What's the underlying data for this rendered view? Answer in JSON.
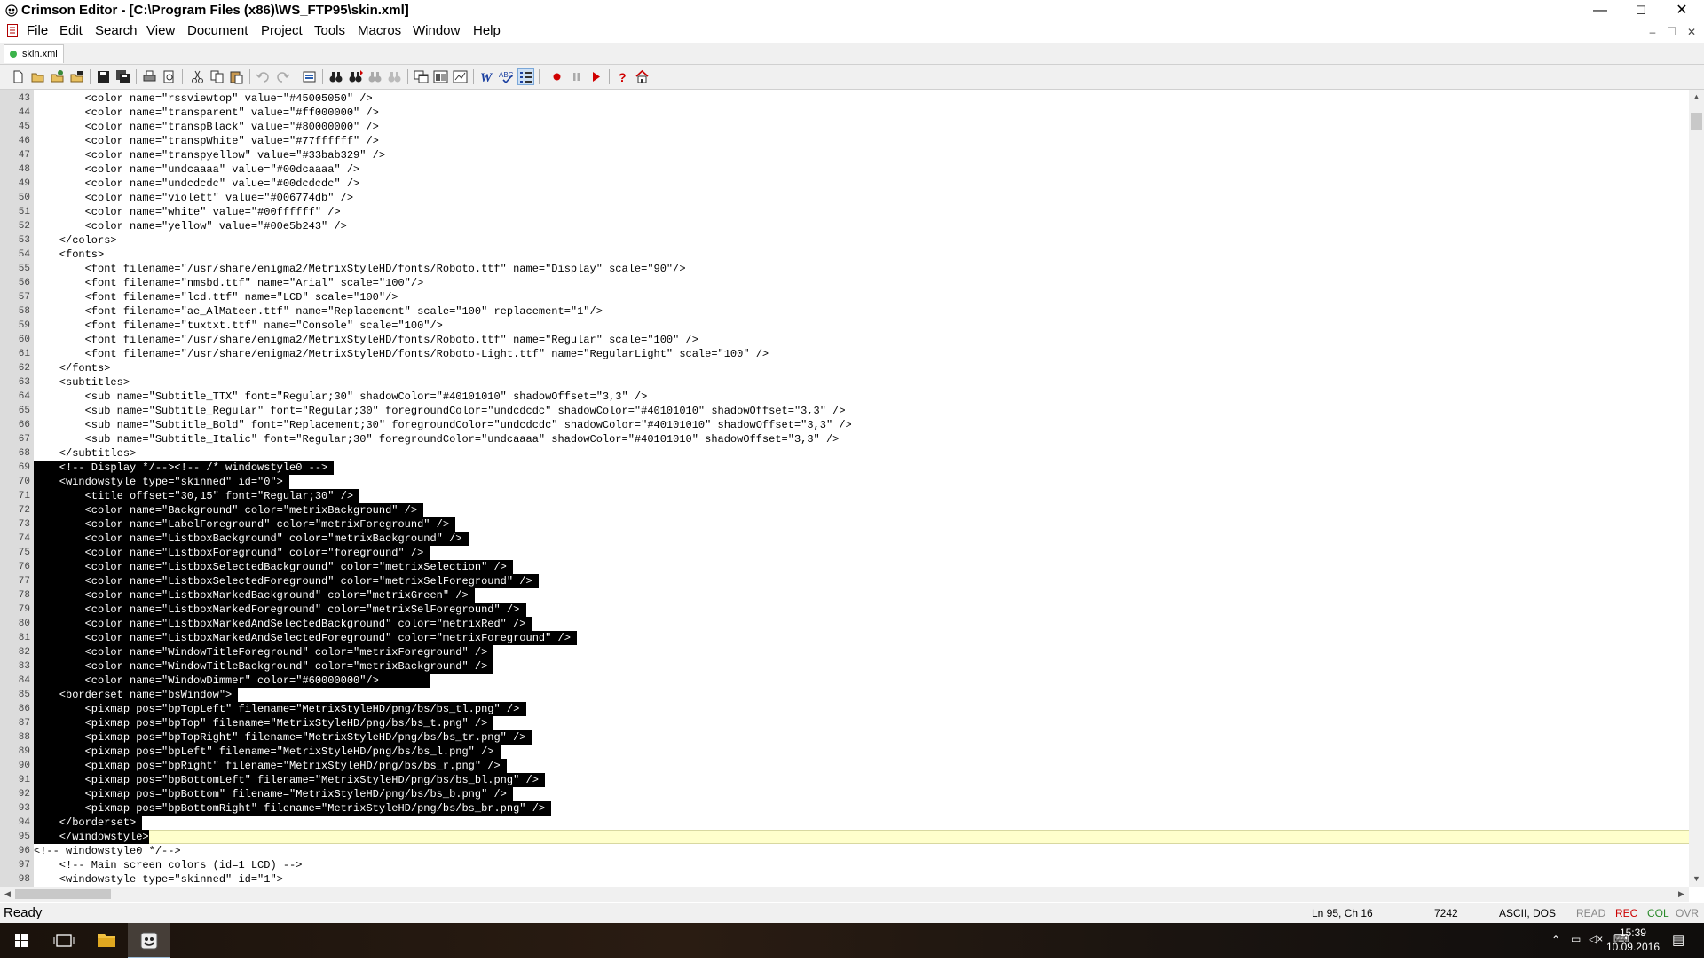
{
  "window": {
    "title": "Crimson Editor - [C:\\Program Files (x86)\\WS_FTP95\\skin.xml]",
    "controls": {
      "minimize": "—",
      "maximize": "☐",
      "close": "✕"
    }
  },
  "menu": [
    "File",
    "Edit",
    "Search",
    "View",
    "Document",
    "Project",
    "Tools",
    "Macros",
    "Window",
    "Help"
  ],
  "mdi_controls": {
    "minimize": "–",
    "restore": "❐",
    "close": "✕"
  },
  "tabs": [
    {
      "label": "skin.xml"
    }
  ],
  "toolbar_icons": [
    "new-file-icon",
    "open-folder-icon",
    "open-remote-icon",
    "close-file-icon",
    "save-icon",
    "save-all-icon",
    "print-icon",
    "print-preview-icon",
    "cut-icon",
    "copy-icon",
    "paste-icon",
    "undo-icon",
    "redo-icon",
    "select-block-icon",
    "find-icon",
    "find-next-icon",
    "replace-icon",
    "goto-icon",
    "word-wrap-icon",
    "spell-check-icon",
    "line-numbers-icon",
    "record-macro-icon",
    "pause-macro-icon",
    "play-macro-icon",
    "help-icon",
    "home-icon"
  ],
  "colors": {
    "selection_bg": "#000000",
    "selection_fg": "#ffffff",
    "current_line_bg": "#ffffcc",
    "gutter_bg": "#dcdcdc"
  },
  "editor": {
    "lines": [
      {
        "num": "43",
        "text": "        <color name=\"rssviewtop\" value=\"#45005050\" />"
      },
      {
        "num": "44",
        "text": "        <color name=\"transparent\" value=\"#ff000000\" />"
      },
      {
        "num": "45",
        "text": "        <color name=\"transpBlack\" value=\"#80000000\" />"
      },
      {
        "num": "46",
        "text": "        <color name=\"transpWhite\" value=\"#77ffffff\" />"
      },
      {
        "num": "47",
        "text": "        <color name=\"transpyellow\" value=\"#33bab329\" />"
      },
      {
        "num": "48",
        "text": "        <color name=\"undcaaaa\" value=\"#00dcaaaa\" />"
      },
      {
        "num": "49",
        "text": "        <color name=\"undcdcdc\" value=\"#00dcdcdc\" />"
      },
      {
        "num": "50",
        "text": "        <color name=\"violett\" value=\"#006774db\" />"
      },
      {
        "num": "51",
        "text": "        <color name=\"white\" value=\"#00ffffff\" />"
      },
      {
        "num": "52",
        "text": "        <color name=\"yellow\" value=\"#00e5b243\" />"
      },
      {
        "num": "53",
        "text": "    </colors>"
      },
      {
        "num": "54",
        "text": "    <fonts>"
      },
      {
        "num": "55",
        "text": "        <font filename=\"/usr/share/enigma2/MetrixStyleHD/fonts/Roboto.ttf\" name=\"Display\" scale=\"90\"/>"
      },
      {
        "num": "56",
        "text": "        <font filename=\"nmsbd.ttf\" name=\"Arial\" scale=\"100\"/>"
      },
      {
        "num": "57",
        "text": "        <font filename=\"lcd.ttf\" name=\"LCD\" scale=\"100\"/>"
      },
      {
        "num": "58",
        "text": "        <font filename=\"ae_AlMateen.ttf\" name=\"Replacement\" scale=\"100\" replacement=\"1\"/>"
      },
      {
        "num": "59",
        "text": "        <font filename=\"tuxtxt.ttf\" name=\"Console\" scale=\"100\"/>"
      },
      {
        "num": "60",
        "text": "        <font filename=\"/usr/share/enigma2/MetrixStyleHD/fonts/Roboto.ttf\" name=\"Regular\" scale=\"100\" />"
      },
      {
        "num": "61",
        "text": "        <font filename=\"/usr/share/enigma2/MetrixStyleHD/fonts/Roboto-Light.ttf\" name=\"RegularLight\" scale=\"100\" />"
      },
      {
        "num": "62",
        "text": "    </fonts>"
      },
      {
        "num": "63",
        "text": "    <subtitles>"
      },
      {
        "num": "64",
        "text": "        <sub name=\"Subtitle_TTX\" font=\"Regular;30\" shadowColor=\"#40101010\" shadowOffset=\"3,3\" />"
      },
      {
        "num": "65",
        "text": "        <sub name=\"Subtitle_Regular\" font=\"Regular;30\" foregroundColor=\"undcdcdc\" shadowColor=\"#40101010\" shadowOffset=\"3,3\" />"
      },
      {
        "num": "66",
        "text": "        <sub name=\"Subtitle_Bold\" font=\"Replacement;30\" foregroundColor=\"undcdcdc\" shadowColor=\"#40101010\" shadowOffset=\"3,3\" />"
      },
      {
        "num": "67",
        "text": "        <sub name=\"Subtitle_Italic\" font=\"Regular;30\" foregroundColor=\"undcaaaa\" shadowColor=\"#40101010\" shadowOffset=\"3,3\" />"
      },
      {
        "num": "68",
        "text": "    </subtitles>"
      },
      {
        "num": "69",
        "text": "    <!-- Display */--><!-- /* windowstyle0 --> ",
        "sel": true
      },
      {
        "num": "70",
        "text": "    <windowstyle type=\"skinned\" id=\"0\"> ",
        "sel": true
      },
      {
        "num": "71",
        "text": "        <title offset=\"30,15\" font=\"Regular;30\" /> ",
        "sel": true
      },
      {
        "num": "72",
        "text": "        <color name=\"Background\" color=\"metrixBackground\" /> ",
        "sel": true
      },
      {
        "num": "73",
        "text": "        <color name=\"LabelForeground\" color=\"metrixForeground\" /> ",
        "sel": true
      },
      {
        "num": "74",
        "text": "        <color name=\"ListboxBackground\" color=\"metrixBackground\" /> ",
        "sel": true
      },
      {
        "num": "75",
        "text": "        <color name=\"ListboxForeground\" color=\"foreground\" /> ",
        "sel": true
      },
      {
        "num": "76",
        "text": "        <color name=\"ListboxSelectedBackground\" color=\"metrixSelection\" /> ",
        "sel": true
      },
      {
        "num": "77",
        "text": "        <color name=\"ListboxSelectedForeground\" color=\"metrixSelForeground\" /> ",
        "sel": true
      },
      {
        "num": "78",
        "text": "        <color name=\"ListboxMarkedBackground\" color=\"metrixGreen\" /> ",
        "sel": true
      },
      {
        "num": "79",
        "text": "        <color name=\"ListboxMarkedForeground\" color=\"metrixSelForeground\" /> ",
        "sel": true
      },
      {
        "num": "80",
        "text": "        <color name=\"ListboxMarkedAndSelectedBackground\" color=\"metrixRed\" /> ",
        "sel": true
      },
      {
        "num": "81",
        "text": "        <color name=\"ListboxMarkedAndSelectedForeground\" color=\"metrixForeground\" /> ",
        "sel": true
      },
      {
        "num": "82",
        "text": "        <color name=\"WindowTitleForeground\" color=\"metrixForeground\" /> ",
        "sel": true
      },
      {
        "num": "83",
        "text": "        <color name=\"WindowTitleBackground\" color=\"metrixBackground\" /> ",
        "sel": true
      },
      {
        "num": "84",
        "text": "        <color name=\"WindowDimmer\" color=\"#60000000\"/>        ",
        "sel": true
      },
      {
        "num": "85",
        "text": "    <borderset name=\"bsWindow\"> ",
        "sel": true
      },
      {
        "num": "86",
        "text": "        <pixmap pos=\"bpTopLeft\" filename=\"MetrixStyleHD/png/bs/bs_tl.png\" /> ",
        "sel": true
      },
      {
        "num": "87",
        "text": "        <pixmap pos=\"bpTop\" filename=\"MetrixStyleHD/png/bs/bs_t.png\" /> ",
        "sel": true
      },
      {
        "num": "88",
        "text": "        <pixmap pos=\"bpTopRight\" filename=\"MetrixStyleHD/png/bs/bs_tr.png\" /> ",
        "sel": true
      },
      {
        "num": "89",
        "text": "        <pixmap pos=\"bpLeft\" filename=\"MetrixStyleHD/png/bs/bs_l.png\" /> ",
        "sel": true
      },
      {
        "num": "90",
        "text": "        <pixmap pos=\"bpRight\" filename=\"MetrixStyleHD/png/bs/bs_r.png\" /> ",
        "sel": true
      },
      {
        "num": "91",
        "text": "        <pixmap pos=\"bpBottomLeft\" filename=\"MetrixStyleHD/png/bs/bs_bl.png\" /> ",
        "sel": true
      },
      {
        "num": "92",
        "text": "        <pixmap pos=\"bpBottom\" filename=\"MetrixStyleHD/png/bs/bs_b.png\" /> ",
        "sel": true
      },
      {
        "num": "93",
        "text": "        <pixmap pos=\"bpBottomRight\" filename=\"MetrixStyleHD/png/bs/bs_br.png\" /> ",
        "sel": true
      },
      {
        "num": "94",
        "text": "    </borderset> ",
        "sel": true
      },
      {
        "num": "95",
        "text": "    </windowstyle>",
        "sel": true,
        "current": true
      },
      {
        "num": "96",
        "text": "<!-- windowstyle0 */-->"
      },
      {
        "num": "97",
        "text": "    <!-- Main screen colors (id=1 LCD) -->"
      },
      {
        "num": "98",
        "text": "    <windowstyle type=\"skinned\" id=\"1\">"
      }
    ]
  },
  "status": {
    "ready": "Ready",
    "position": "Ln 95, Ch 16",
    "size": "7242",
    "encoding": "ASCII, DOS",
    "flags": [
      "READ",
      "REC",
      "COL",
      "OVR"
    ]
  },
  "tray": {
    "time": "15:39",
    "date": "10.09.2016"
  }
}
